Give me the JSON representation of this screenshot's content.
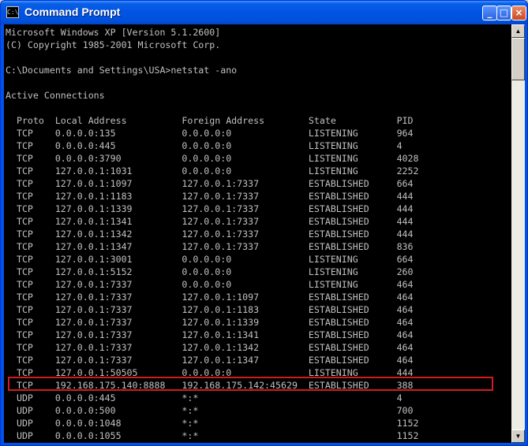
{
  "window": {
    "title": "Command Prompt",
    "icon_label": "C:\\",
    "buttons": {
      "minimize": "_",
      "maximize": "□",
      "close": "×"
    }
  },
  "console": {
    "lines": [
      "Microsoft Windows XP [Version 5.1.2600]",
      "(C) Copyright 1985-2001 Microsoft Corp.",
      "",
      "C:\\Documents and Settings\\USA>netstat -ano",
      "",
      "Active Connections",
      "",
      "  Proto  Local Address          Foreign Address        State           PID",
      "  TCP    0.0.0.0:135            0.0.0.0:0              LISTENING       964",
      "  TCP    0.0.0.0:445            0.0.0.0:0              LISTENING       4",
      "  TCP    0.0.0.0:3790           0.0.0.0:0              LISTENING       4028",
      "  TCP    127.0.0.1:1031         0.0.0.0:0              LISTENING       2252",
      "  TCP    127.0.0.1:1097         127.0.0.1:7337         ESTABLISHED     664",
      "  TCP    127.0.0.1:1183         127.0.0.1:7337         ESTABLISHED     444",
      "  TCP    127.0.0.1:1339         127.0.0.1:7337         ESTABLISHED     444",
      "  TCP    127.0.0.1:1341         127.0.0.1:7337         ESTABLISHED     444",
      "  TCP    127.0.0.1:1342         127.0.0.1:7337         ESTABLISHED     444",
      "  TCP    127.0.0.1:1347         127.0.0.1:7337         ESTABLISHED     836",
      "  TCP    127.0.0.1:3001         0.0.0.0:0              LISTENING       664",
      "  TCP    127.0.0.1:5152         0.0.0.0:0              LISTENING       260",
      "  TCP    127.0.0.1:7337         0.0.0.0:0              LISTENING       464",
      "  TCP    127.0.0.1:7337         127.0.0.1:1097         ESTABLISHED     464",
      "  TCP    127.0.0.1:7337         127.0.0.1:1183         ESTABLISHED     464",
      "  TCP    127.0.0.1:7337         127.0.0.1:1339         ESTABLISHED     464",
      "  TCP    127.0.0.1:7337         127.0.0.1:1341         ESTABLISHED     464",
      "  TCP    127.0.0.1:7337         127.0.0.1:1342         ESTABLISHED     464",
      "  TCP    127.0.0.1:7337         127.0.0.1:1347         ESTABLISHED     464",
      "  TCP    127.0.0.1:50505        0.0.0.0:0              LISTENING       444",
      "  TCP    192.168.175.140:8888   192.168.175.142:45629  ESTABLISHED     388",
      "  UDP    0.0.0.0:445            *:*                                    4",
      "  UDP    0.0.0.0:500            *:*                                    700",
      "  UDP    0.0.0.0:1048           *:*                                    1152",
      "  UDP    0.0.0.0:1055           *:*                                    1152"
    ]
  },
  "highlight": {
    "row": "TCP 192.168.175.140:8888 192.168.175.142:45629 ESTABLISHED 388",
    "color": "#d21c1c"
  },
  "scrollbar": {
    "up": "▲",
    "down": "▼"
  },
  "colors": {
    "console_bg": "#000000",
    "console_text": "#c0c0c0",
    "titlebar": "#0054e3"
  }
}
